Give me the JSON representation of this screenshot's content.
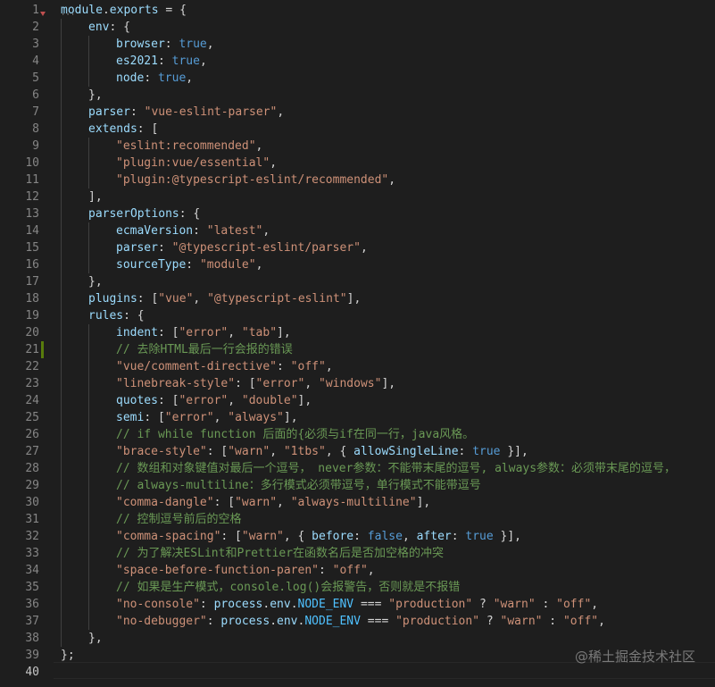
{
  "editor": {
    "active_line": 40,
    "modified_line": 21,
    "lines": [
      {
        "n": "1",
        "indent": 0,
        "tokens": [
          [
            "var",
            "module"
          ],
          [
            "pun",
            "."
          ],
          [
            "var",
            "exports"
          ],
          [
            "pun",
            " = {"
          ]
        ]
      },
      {
        "n": "2",
        "indent": 1,
        "tokens": [
          [
            "var",
            "env"
          ],
          [
            "pun",
            ": {"
          ]
        ]
      },
      {
        "n": "3",
        "indent": 2,
        "tokens": [
          [
            "var",
            "browser"
          ],
          [
            "pun",
            ": "
          ],
          [
            "kw",
            "true"
          ],
          [
            "pun",
            ","
          ]
        ]
      },
      {
        "n": "4",
        "indent": 2,
        "tokens": [
          [
            "var",
            "es2021"
          ],
          [
            "pun",
            ": "
          ],
          [
            "kw",
            "true"
          ],
          [
            "pun",
            ","
          ]
        ]
      },
      {
        "n": "5",
        "indent": 2,
        "tokens": [
          [
            "var",
            "node"
          ],
          [
            "pun",
            ": "
          ],
          [
            "kw",
            "true"
          ],
          [
            "pun",
            ","
          ]
        ]
      },
      {
        "n": "6",
        "indent": 1,
        "tokens": [
          [
            "pun",
            "},"
          ]
        ]
      },
      {
        "n": "7",
        "indent": 1,
        "tokens": [
          [
            "var",
            "parser"
          ],
          [
            "pun",
            ": "
          ],
          [
            "str",
            "\"vue-eslint-parser\""
          ],
          [
            "pun",
            ","
          ]
        ]
      },
      {
        "n": "8",
        "indent": 1,
        "tokens": [
          [
            "var",
            "extends"
          ],
          [
            "pun",
            ": ["
          ]
        ]
      },
      {
        "n": "9",
        "indent": 2,
        "tokens": [
          [
            "str",
            "\"eslint:recommended\""
          ],
          [
            "pun",
            ","
          ]
        ]
      },
      {
        "n": "10",
        "indent": 2,
        "tokens": [
          [
            "str",
            "\"plugin:vue/essential\""
          ],
          [
            "pun",
            ","
          ]
        ]
      },
      {
        "n": "11",
        "indent": 2,
        "tokens": [
          [
            "str",
            "\"plugin:@typescript-eslint/recommended\""
          ],
          [
            "pun",
            ","
          ]
        ]
      },
      {
        "n": "12",
        "indent": 1,
        "tokens": [
          [
            "pun",
            "],"
          ]
        ]
      },
      {
        "n": "13",
        "indent": 1,
        "tokens": [
          [
            "var",
            "parserOptions"
          ],
          [
            "pun",
            ": {"
          ]
        ]
      },
      {
        "n": "14",
        "indent": 2,
        "tokens": [
          [
            "var",
            "ecmaVersion"
          ],
          [
            "pun",
            ": "
          ],
          [
            "str",
            "\"latest\""
          ],
          [
            "pun",
            ","
          ]
        ]
      },
      {
        "n": "15",
        "indent": 2,
        "tokens": [
          [
            "var",
            "parser"
          ],
          [
            "pun",
            ": "
          ],
          [
            "str",
            "\"@typescript-eslint/parser\""
          ],
          [
            "pun",
            ","
          ]
        ]
      },
      {
        "n": "16",
        "indent": 2,
        "tokens": [
          [
            "var",
            "sourceType"
          ],
          [
            "pun",
            ": "
          ],
          [
            "str",
            "\"module\""
          ],
          [
            "pun",
            ","
          ]
        ]
      },
      {
        "n": "17",
        "indent": 1,
        "tokens": [
          [
            "pun",
            "},"
          ]
        ]
      },
      {
        "n": "18",
        "indent": 1,
        "tokens": [
          [
            "var",
            "plugins"
          ],
          [
            "pun",
            ": ["
          ],
          [
            "str",
            "\"vue\""
          ],
          [
            "pun",
            ", "
          ],
          [
            "str",
            "\"@typescript-eslint\""
          ],
          [
            "pun",
            "],"
          ]
        ]
      },
      {
        "n": "19",
        "indent": 1,
        "tokens": [
          [
            "var",
            "rules"
          ],
          [
            "pun",
            ": {"
          ]
        ]
      },
      {
        "n": "20",
        "indent": 2,
        "tokens": [
          [
            "var",
            "indent"
          ],
          [
            "pun",
            ": ["
          ],
          [
            "str",
            "\"error\""
          ],
          [
            "pun",
            ", "
          ],
          [
            "str",
            "\"tab\""
          ],
          [
            "pun",
            "],"
          ]
        ]
      },
      {
        "n": "21",
        "indent": 2,
        "tokens": [
          [
            "com",
            "// 去除HTML最后一行会报的错误"
          ]
        ]
      },
      {
        "n": "22",
        "indent": 2,
        "tokens": [
          [
            "str",
            "\"vue/comment-directive\""
          ],
          [
            "pun",
            ": "
          ],
          [
            "str",
            "\"off\""
          ],
          [
            "pun",
            ","
          ]
        ]
      },
      {
        "n": "23",
        "indent": 2,
        "tokens": [
          [
            "str",
            "\"linebreak-style\""
          ],
          [
            "pun",
            ": ["
          ],
          [
            "str",
            "\"error\""
          ],
          [
            "pun",
            ", "
          ],
          [
            "str",
            "\"windows\""
          ],
          [
            "pun",
            "],"
          ]
        ]
      },
      {
        "n": "24",
        "indent": 2,
        "tokens": [
          [
            "var",
            "quotes"
          ],
          [
            "pun",
            ": ["
          ],
          [
            "str",
            "\"error\""
          ],
          [
            "pun",
            ", "
          ],
          [
            "str",
            "\"double\""
          ],
          [
            "pun",
            "],"
          ]
        ]
      },
      {
        "n": "25",
        "indent": 2,
        "tokens": [
          [
            "var",
            "semi"
          ],
          [
            "pun",
            ": ["
          ],
          [
            "str",
            "\"error\""
          ],
          [
            "pun",
            ", "
          ],
          [
            "str",
            "\"always\""
          ],
          [
            "pun",
            "],"
          ]
        ]
      },
      {
        "n": "26",
        "indent": 2,
        "tokens": [
          [
            "com",
            "// if while function 后面的{必须与if在同一行，java风格。"
          ]
        ]
      },
      {
        "n": "27",
        "indent": 2,
        "tokens": [
          [
            "str",
            "\"brace-style\""
          ],
          [
            "pun",
            ": ["
          ],
          [
            "str",
            "\"warn\""
          ],
          [
            "pun",
            ", "
          ],
          [
            "str",
            "\"1tbs\""
          ],
          [
            "pun",
            ", { "
          ],
          [
            "var",
            "allowSingleLine"
          ],
          [
            "pun",
            ": "
          ],
          [
            "kw",
            "true"
          ],
          [
            "pun",
            " }],"
          ]
        ]
      },
      {
        "n": "28",
        "indent": 2,
        "tokens": [
          [
            "com",
            "// 数组和对象键值对最后一个逗号， never参数：不能带末尾的逗号, always参数：必须带末尾的逗号，"
          ]
        ]
      },
      {
        "n": "29",
        "indent": 2,
        "tokens": [
          [
            "com",
            "// always-multiline：多行模式必须带逗号，单行模式不能带逗号"
          ]
        ]
      },
      {
        "n": "30",
        "indent": 2,
        "tokens": [
          [
            "str",
            "\"comma-dangle\""
          ],
          [
            "pun",
            ": ["
          ],
          [
            "str",
            "\"warn\""
          ],
          [
            "pun",
            ", "
          ],
          [
            "str",
            "\"always-multiline\""
          ],
          [
            "pun",
            "],"
          ]
        ]
      },
      {
        "n": "31",
        "indent": 2,
        "tokens": [
          [
            "com",
            "// 控制逗号前后的空格"
          ]
        ]
      },
      {
        "n": "32",
        "indent": 2,
        "tokens": [
          [
            "str",
            "\"comma-spacing\""
          ],
          [
            "pun",
            ": ["
          ],
          [
            "str",
            "\"warn\""
          ],
          [
            "pun",
            ", { "
          ],
          [
            "var",
            "before"
          ],
          [
            "pun",
            ": "
          ],
          [
            "kw",
            "false"
          ],
          [
            "pun",
            ", "
          ],
          [
            "var",
            "after"
          ],
          [
            "pun",
            ": "
          ],
          [
            "kw",
            "true"
          ],
          [
            "pun",
            " }],"
          ]
        ]
      },
      {
        "n": "33",
        "indent": 2,
        "tokens": [
          [
            "com",
            "// 为了解决ESLint和Prettier在函数名后是否加空格的冲突"
          ]
        ]
      },
      {
        "n": "34",
        "indent": 2,
        "tokens": [
          [
            "str",
            "\"space-before-function-paren\""
          ],
          [
            "pun",
            ": "
          ],
          [
            "str",
            "\"off\""
          ],
          [
            "pun",
            ","
          ]
        ]
      },
      {
        "n": "35",
        "indent": 2,
        "tokens": [
          [
            "com",
            "// 如果是生产模式，console.log()会报警告，否则就是不报错"
          ]
        ]
      },
      {
        "n": "36",
        "indent": 2,
        "tokens": [
          [
            "str",
            "\"no-console\""
          ],
          [
            "pun",
            ": "
          ],
          [
            "var",
            "process"
          ],
          [
            "pun",
            "."
          ],
          [
            "var",
            "env"
          ],
          [
            "pun",
            "."
          ],
          [
            "const",
            "NODE_ENV"
          ],
          [
            "pun",
            " === "
          ],
          [
            "str",
            "\"production\""
          ],
          [
            "pun",
            " ? "
          ],
          [
            "str",
            "\"warn\""
          ],
          [
            "pun",
            " : "
          ],
          [
            "str",
            "\"off\""
          ],
          [
            "pun",
            ","
          ]
        ]
      },
      {
        "n": "37",
        "indent": 2,
        "tokens": [
          [
            "str",
            "\"no-debugger\""
          ],
          [
            "pun",
            ": "
          ],
          [
            "var",
            "process"
          ],
          [
            "pun",
            "."
          ],
          [
            "var",
            "env"
          ],
          [
            "pun",
            "."
          ],
          [
            "const",
            "NODE_ENV"
          ],
          [
            "pun",
            " === "
          ],
          [
            "str",
            "\"production\""
          ],
          [
            "pun",
            " ? "
          ],
          [
            "str",
            "\"warn\""
          ],
          [
            "pun",
            " : "
          ],
          [
            "str",
            "\"off\""
          ],
          [
            "pun",
            ","
          ]
        ]
      },
      {
        "n": "38",
        "indent": 1,
        "tokens": [
          [
            "pun",
            "},"
          ]
        ]
      },
      {
        "n": "39",
        "indent": 0,
        "tokens": [
          [
            "pun",
            "};"
          ]
        ]
      },
      {
        "n": "40",
        "indent": 0,
        "tokens": []
      }
    ]
  },
  "watermark": "@稀土掘金技术社区",
  "colors": {
    "background": "#1e1e1e",
    "line_number": "#858585",
    "variable": "#9cdcfe",
    "string": "#ce9178",
    "keyword": "#569cd6",
    "comment": "#6a9955",
    "constant": "#4fc1ff",
    "punctuation": "#d4d4d4"
  }
}
